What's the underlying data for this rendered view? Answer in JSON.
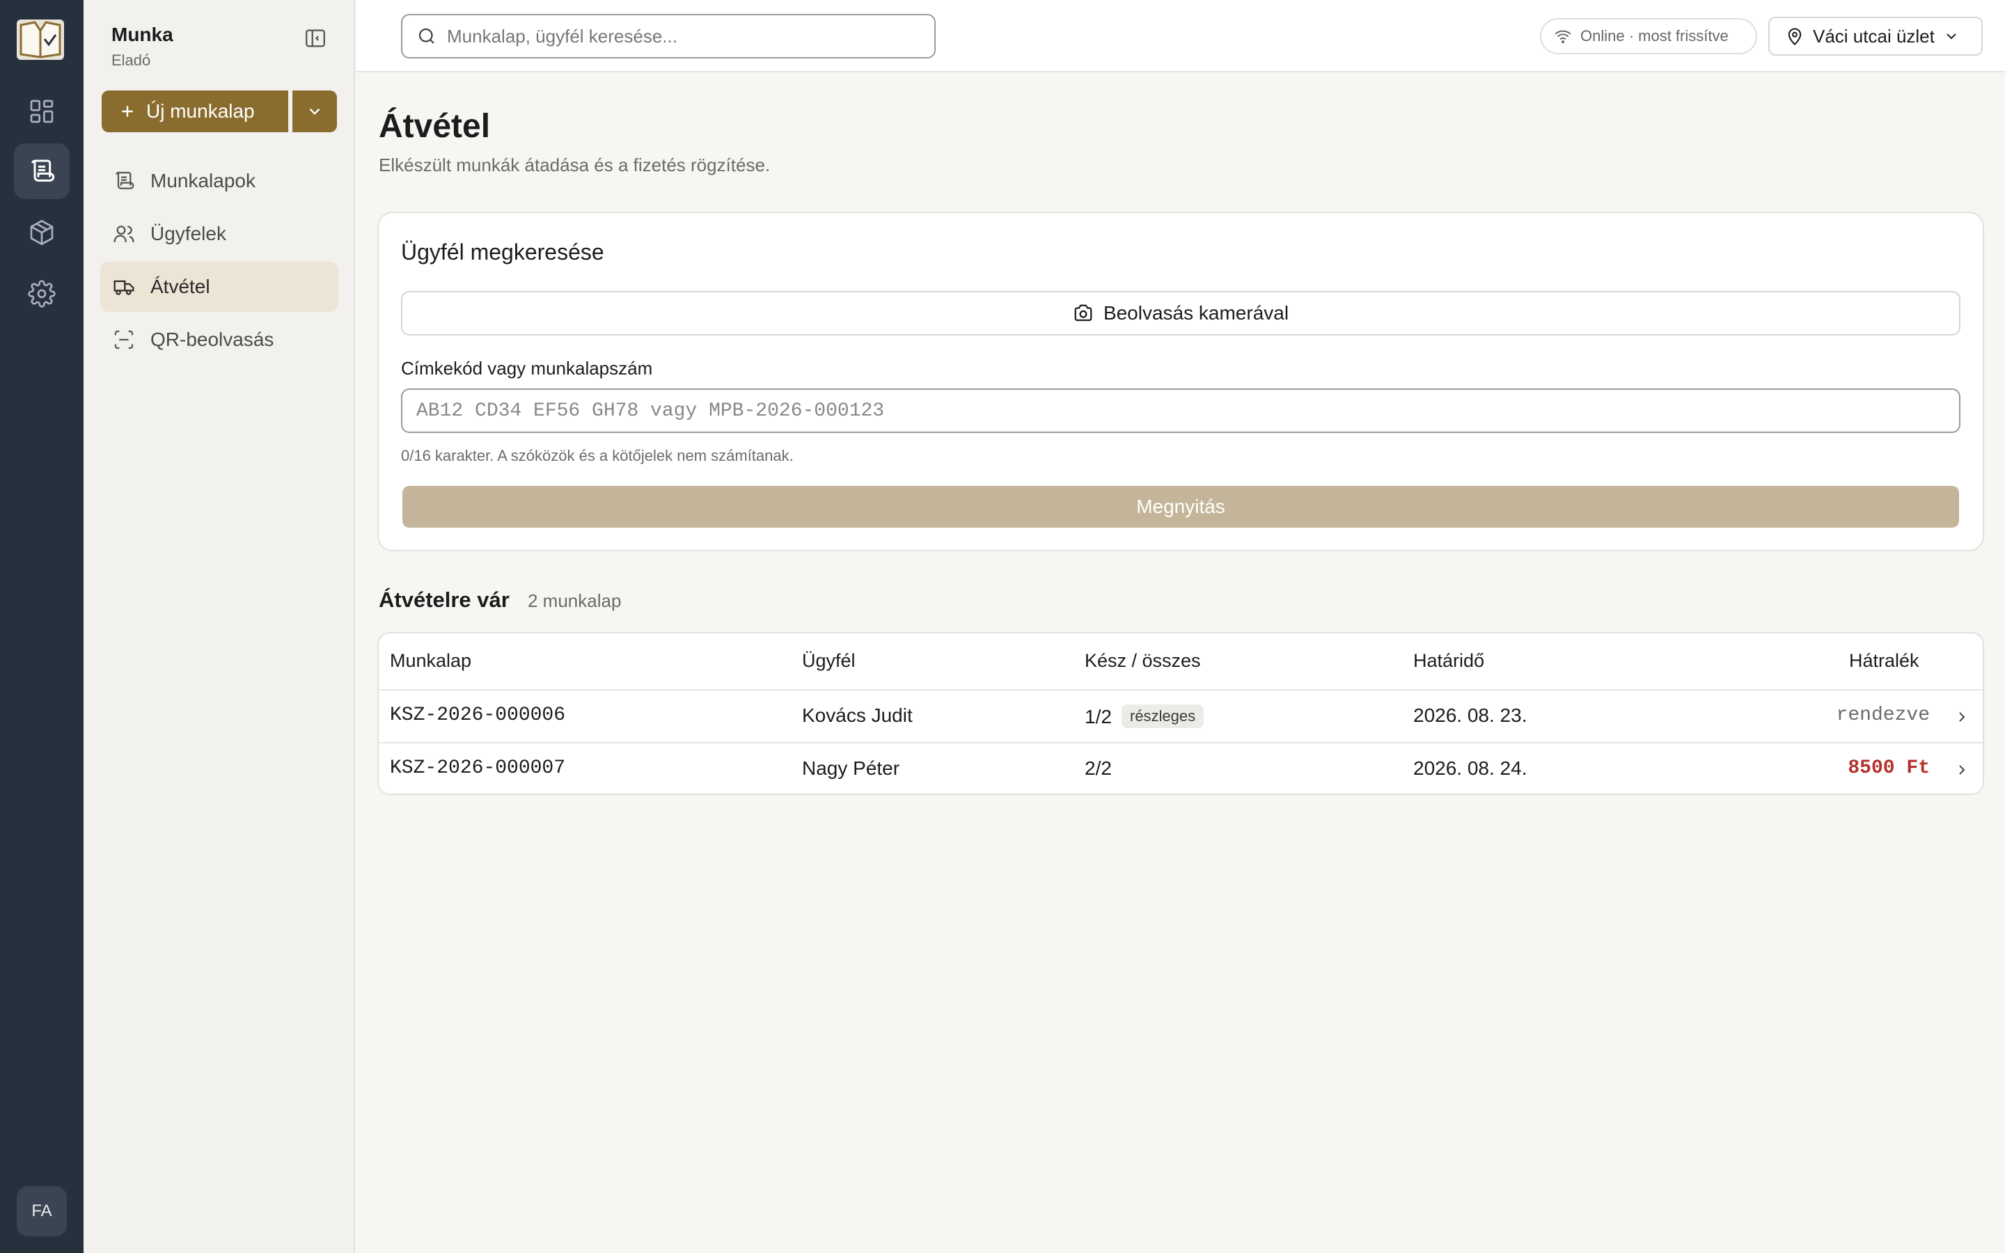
{
  "app": {
    "title": "Munka",
    "role": "Eladó"
  },
  "rail": {
    "items": [
      {
        "icon": "dashboard-icon"
      },
      {
        "icon": "worksheet-icon",
        "active": true
      },
      {
        "icon": "package-icon"
      },
      {
        "icon": "gear-icon"
      }
    ],
    "avatar_initials": "FA"
  },
  "sidebar": {
    "new_button_label": "Új munkalap",
    "items": [
      {
        "label": "Munkalapok",
        "icon": "worksheet-icon"
      },
      {
        "label": "Ügyfelek",
        "icon": "users-icon"
      },
      {
        "label": "Átvétel",
        "icon": "truck-icon",
        "active": true
      },
      {
        "label": "QR-beolvasás",
        "icon": "scan-icon"
      }
    ]
  },
  "topbar": {
    "search_placeholder": "Munkalap, ügyfél keresése...",
    "status": "Online · most frissítve",
    "store": "Váci utcai üzlet"
  },
  "page": {
    "title": "Átvétel",
    "subtitle": "Elkészült munkák átadása és a fizetés rögzítése."
  },
  "lookup": {
    "title": "Ügyfél megkeresése",
    "camera_button": "Beolvasás kamerával",
    "field_label": "Címkekód vagy munkalapszám",
    "field_placeholder": "AB12 CD34 EF56 GH78 vagy MPB-2026-000123",
    "hint": "0/16 karakter. A szóközök és a kötőjelek nem számítanak.",
    "open_button": "Megnyitás"
  },
  "pending": {
    "title": "Átvételre vár",
    "count": "2 munkalap",
    "columns": [
      "Munkalap",
      "Ügyfél",
      "Kész / összes",
      "Határidő",
      "Hátralék"
    ],
    "rows": [
      {
        "id": "KSZ-2026-000006",
        "customer": "Kovács Judit",
        "progress": "1/2",
        "badge": "részleges",
        "due": "2026. 08. 23.",
        "balance": "rendezve",
        "balance_color": "#6b6b6b"
      },
      {
        "id": "KSZ-2026-000007",
        "customer": "Nagy Péter",
        "progress": "2/2",
        "badge": "",
        "due": "2026. 08. 24.",
        "balance": "8500 Ft",
        "balance_color": "#b3312b"
      }
    ]
  },
  "colors": {
    "accent": "#8a6d2e",
    "accent_soft": "#ece4d5",
    "rail": "#27303d",
    "debt": "#b3312b"
  }
}
